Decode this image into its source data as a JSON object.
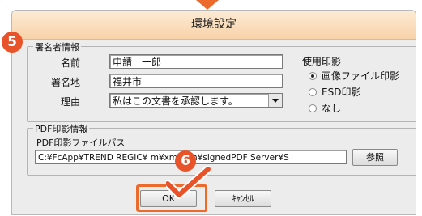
{
  "window": {
    "title": "環境設定"
  },
  "signer": {
    "group_label": "署名者情報",
    "name_label": "名前",
    "name_value": "申請　一郎",
    "place_label": "署名地",
    "place_value": "福井市",
    "reason_label": "理由",
    "reason_value": "私はこの文書を承認します。"
  },
  "stamp": {
    "group_label": "使用印影",
    "options": [
      "画像ファイル印影",
      "ESD印影",
      "なし"
    ],
    "selected": "画像ファイル印影"
  },
  "pdf_stamp": {
    "group_label": "PDF印影情報",
    "path_label": "PDF印影ファイルパス",
    "path_value": "C:¥FcApp¥TREND REGIC¥        m¥xmlsign¥signedPDF Server¥S",
    "browse_label": "参照"
  },
  "footer": {
    "ok_label": "OK",
    "cancel_label": "ｷｬﾝｾﾙ"
  },
  "annotations": {
    "step5": "5",
    "step6": "6"
  },
  "colors": {
    "accent": "#ec6a2c",
    "badge": "#e8532a"
  },
  "icons": {
    "dropdown": "chevron-down-icon",
    "pointer": "check-pointer-icon"
  }
}
